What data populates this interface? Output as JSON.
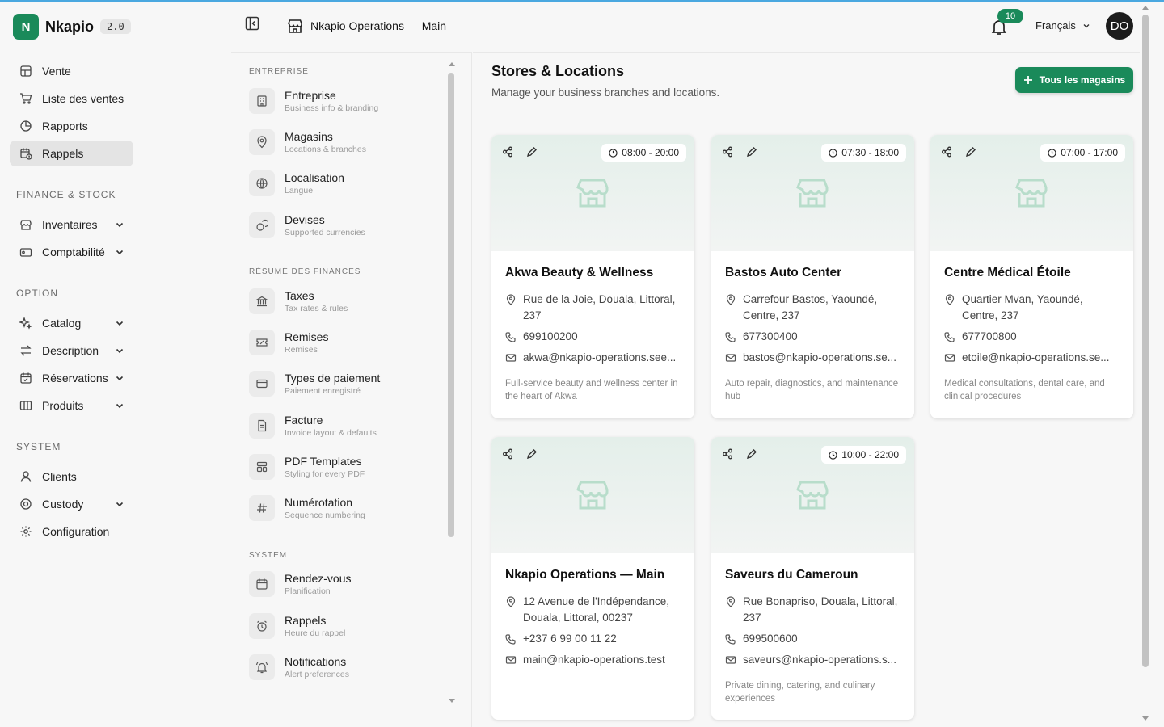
{
  "app": {
    "name": "Nkapio",
    "version": "2.0",
    "logo_letter": "N"
  },
  "sidebar": {
    "items_top": [
      {
        "label": "Vente",
        "icon": "pos-icon"
      },
      {
        "label": "Liste des ventes",
        "icon": "cart-icon"
      },
      {
        "label": "Rapports",
        "icon": "pie-chart-icon"
      },
      {
        "label": "Rappels",
        "icon": "calendar-clock-icon",
        "active": true
      }
    ],
    "sections": {
      "finance": "FINANCE & STOCK",
      "option": "OPTION",
      "system": "SYSTEM"
    },
    "finance_items": [
      {
        "label": "Inventaires"
      },
      {
        "label": "Comptabilité"
      }
    ],
    "option_items": [
      {
        "label": "Catalog"
      },
      {
        "label": "Description"
      },
      {
        "label": "Réservations"
      },
      {
        "label": "Produits"
      }
    ],
    "system_items": [
      {
        "label": "Clients"
      },
      {
        "label": "Custody"
      },
      {
        "label": "Configuration"
      }
    ]
  },
  "header": {
    "store_name": "Nkapio Operations — Main",
    "notifications_count": "10",
    "language": "Français",
    "avatar_initials": "DO"
  },
  "subnav": {
    "sections": {
      "entreprise": "ENTREPRISE",
      "finances": "RÉSUMÉ DES FINANCES",
      "system": "SYSTEM"
    },
    "entreprise": [
      {
        "title": "Entreprise",
        "desc": "Business info & branding"
      },
      {
        "title": "Magasins",
        "desc": "Locations & branches"
      },
      {
        "title": "Localisation",
        "desc": "Langue"
      },
      {
        "title": "Devises",
        "desc": "Supported currencies"
      }
    ],
    "finances": [
      {
        "title": "Taxes",
        "desc": "Tax rates & rules"
      },
      {
        "title": "Remises",
        "desc": "Remises"
      },
      {
        "title": "Types de paiement",
        "desc": "Paiement enregistré"
      },
      {
        "title": "Facture",
        "desc": "Invoice layout & defaults"
      },
      {
        "title": "PDF Templates",
        "desc": "Styling for every PDF"
      },
      {
        "title": "Numérotation",
        "desc": "Sequence numbering"
      }
    ],
    "system": [
      {
        "title": "Rendez-vous",
        "desc": "Planification"
      },
      {
        "title": "Rappels",
        "desc": "Heure du rappel"
      },
      {
        "title": "Notifications",
        "desc": "Alert preferences"
      }
    ]
  },
  "main": {
    "title": "Stores & Locations",
    "subtitle": "Manage your business branches and locations.",
    "all_stores_button": "Tous les magasins",
    "stores": [
      {
        "name": "Akwa Beauty & Wellness",
        "hours": "08:00 - 20:00",
        "address": "Rue de la Joie, Douala, Littoral, 237",
        "phone": "699100200",
        "email": "akwa@nkapio-operations.see...",
        "description": "Full-service beauty and wellness center in the heart of Akwa"
      },
      {
        "name": "Bastos Auto Center",
        "hours": "07:30 - 18:00",
        "address": "Carrefour Bastos, Yaoundé, Centre, 237",
        "phone": "677300400",
        "email": "bastos@nkapio-operations.se...",
        "description": "Auto repair, diagnostics, and maintenance hub"
      },
      {
        "name": "Centre Médical Étoile",
        "hours": "07:00 - 17:00",
        "address": "Quartier Mvan, Yaoundé, Centre, 237",
        "phone": "677700800",
        "email": "etoile@nkapio-operations.se...",
        "description": "Medical consultations, dental care, and clinical procedures"
      },
      {
        "name": "Nkapio Operations — Main",
        "hours": "",
        "address": "12 Avenue de l'Indépendance, Douala, Littoral, 00237",
        "phone": "+237 6 99 00 11 22",
        "email": "main@nkapio-operations.test",
        "description": ""
      },
      {
        "name": "Saveurs du Cameroun",
        "hours": "10:00 - 22:00",
        "address": "Rue Bonapriso, Douala, Littoral, 237",
        "phone": "699500600",
        "email": "saveurs@nkapio-operations.s...",
        "description": "Private dining, catering, and culinary experiences"
      }
    ]
  },
  "colors": {
    "brand": "#1a8a5a",
    "topline": "#4aa8e0",
    "avatar_bg": "#1c1c1c"
  }
}
